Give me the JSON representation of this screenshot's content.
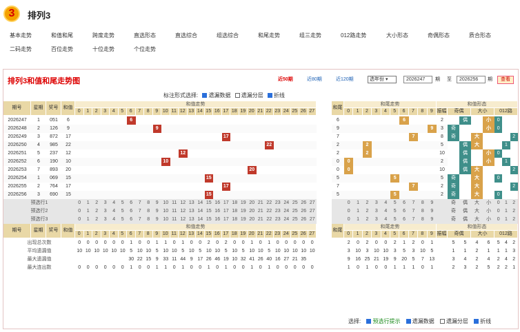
{
  "app": {
    "title": "排列3",
    "logo_text": "3"
  },
  "nav": [
    "基本走势",
    "和值和尾",
    "跨度走势",
    "直选形态",
    "直选综合",
    "组选综合",
    "和尾走势",
    "组三走势",
    "012路走势",
    "大小形态",
    "奇偶形态",
    "质合形态",
    "二码走势",
    "百位走势",
    "十位走势",
    "个位走势"
  ],
  "panel": {
    "title": "排列3和值和尾走势图",
    "quick": [
      "近50期",
      "近80期",
      "近120期"
    ],
    "select": "选年份",
    "from": "2026247",
    "from_suffix": "期",
    "to_label": "至",
    "to": "2026256",
    "to_suffix": "期",
    "query": "查看",
    "opts_label": "标注形式选择:",
    "opts": [
      {
        "label": "遗漏数据",
        "on": true
      },
      {
        "label": "遗漏分层",
        "on": false
      },
      {
        "label": "折线",
        "on": true
      }
    ]
  },
  "table": {
    "h_issue": "期号",
    "h_week": "星期",
    "h_prize": "奖号",
    "h_sum": "和值",
    "h_sumtrend": "和值走势",
    "h_tail": "和尾",
    "h_tailtrend": "和尾走势",
    "h_form": "和值形态",
    "h_switch": "[切换]",
    "h_zhen": "振幅",
    "h_oe": "奇偶",
    "h_bs": "大小",
    "h_012": "012路",
    "sub_odd": "奇",
    "sub_even": "偶",
    "sub_big": "大",
    "sub_small": "小",
    "sub_0": "0",
    "sub_1": "1",
    "sub_2": "2",
    "rows": [
      {
        "issue": "2026247",
        "week": "1",
        "prize": "051",
        "sum": "6",
        "tail": "6",
        "zhen": "2",
        "oe": "偶",
        "bs": "小",
        "m3": "0"
      },
      {
        "issue": "2026248",
        "week": "2",
        "prize": "126",
        "sum": "9",
        "tail": "9",
        "zhen": "3",
        "oe": "奇",
        "bs": "小",
        "m3": "0"
      },
      {
        "issue": "2026249",
        "week": "3",
        "prize": "872",
        "sum": "17",
        "tail": "7",
        "zhen": "8",
        "oe": "奇",
        "bs": "大",
        "m3": "2"
      },
      {
        "issue": "2026250",
        "week": "4",
        "prize": "985",
        "sum": "22",
        "tail": "2",
        "zhen": "5",
        "oe": "偶",
        "bs": "大",
        "m3": "1"
      },
      {
        "issue": "2026251",
        "week": "5",
        "prize": "237",
        "sum": "12",
        "tail": "2",
        "zhen": "10",
        "oe": "偶",
        "bs": "小",
        "m3": "0"
      },
      {
        "issue": "2026252",
        "week": "6",
        "prize": "190",
        "sum": "10",
        "tail": "0",
        "zhen": "2",
        "oe": "偶",
        "bs": "小",
        "m3": "1"
      },
      {
        "issue": "2026253",
        "week": "7",
        "prize": "893",
        "sum": "20",
        "tail": "0",
        "zhen": "10",
        "oe": "偶",
        "bs": "大",
        "m3": "2"
      },
      {
        "issue": "2026254",
        "week": "1",
        "prize": "069",
        "sum": "15",
        "tail": "5",
        "zhen": "5",
        "oe": "奇",
        "bs": "大",
        "m3": "0"
      },
      {
        "issue": "2026255",
        "week": "2",
        "prize": "764",
        "sum": "17",
        "tail": "7",
        "zhen": "2",
        "oe": "奇",
        "bs": "大",
        "m3": "2"
      },
      {
        "issue": "2026256",
        "week": "3",
        "prize": "690",
        "sum": "15",
        "tail": "5",
        "zhen": "2",
        "oe": "奇",
        "bs": "大",
        "m3": "0"
      }
    ],
    "predict": [
      "预选行1",
      "预选行2",
      "预选行3"
    ],
    "stats": [
      {
        "label": "出现总次数",
        "sum": [
          "0",
          "0",
          "0",
          "0",
          "0",
          "0",
          "1",
          "0",
          "0",
          "1",
          "1",
          "0",
          "1",
          "0",
          "0",
          "2",
          "0",
          "2",
          "0",
          "0",
          "1",
          "0",
          "1",
          "0",
          "0",
          "0",
          "0",
          "0"
        ],
        "tail": [
          "2",
          "0",
          "2",
          "0",
          "0",
          "2",
          "1",
          "2",
          "0",
          "1"
        ],
        "zhen": "",
        "form": [
          "5",
          "5",
          "4",
          "6",
          "5",
          "4",
          "2",
          "3"
        ]
      },
      {
        "label": "平均遗漏值",
        "sum": [
          "10",
          "10",
          "10",
          "10",
          "10",
          "10",
          "5",
          "10",
          "10",
          "5",
          "10",
          "10",
          "5",
          "10",
          "5",
          "10",
          "10",
          "5",
          "10",
          "5",
          "10",
          "10",
          "5",
          "10",
          "10",
          "10",
          "10",
          "10"
        ],
        "tail": [
          "3",
          "10",
          "3",
          "10",
          "10",
          "3",
          "5",
          "3",
          "10",
          "5"
        ],
        "zhen": "",
        "form": [
          "1",
          "1",
          "2",
          "1",
          "1",
          "1",
          "3",
          "2"
        ]
      },
      {
        "label": "最大遗漏值",
        "sum": [
          "",
          "",
          "",
          "",
          "",
          "",
          "30",
          "22",
          "15",
          "9",
          "33",
          "11",
          "44",
          "9",
          "17",
          "26",
          "46",
          "19",
          "10",
          "32",
          "41",
          "26",
          "40",
          "16",
          "27",
          "21",
          "35",
          ""
        ],
        "tail": [
          "9",
          "16",
          "25",
          "21",
          "19",
          "9",
          "20",
          "5",
          "7",
          "13"
        ],
        "zhen": "",
        "form": [
          "3",
          "4",
          "2",
          "4",
          "2",
          "4",
          "2",
          "3"
        ]
      },
      {
        "label": "最大连出数",
        "sum": [
          "0",
          "0",
          "0",
          "0",
          "0",
          "0",
          "1",
          "0",
          "0",
          "1",
          "1",
          "0",
          "1",
          "0",
          "0",
          "1",
          "0",
          "1",
          "0",
          "0",
          "1",
          "0",
          "1",
          "0",
          "0",
          "0",
          "0",
          "0"
        ],
        "tail": [
          "1",
          "0",
          "1",
          "0",
          "0",
          "1",
          "1",
          "1",
          "0",
          "1"
        ],
        "zhen": "",
        "form": [
          "2",
          "3",
          "2",
          "5",
          "2",
          "2",
          "1",
          "1"
        ]
      }
    ],
    "legend_label": "选择:",
    "legend": [
      {
        "label": "预选行提示",
        "on": true
      },
      {
        "label": "遗漏数据",
        "on": true
      },
      {
        "label": "遗漏分层",
        "on": false
      },
      {
        "label": "折线",
        "on": true
      }
    ]
  },
  "colors": {
    "hit": "#c0392b",
    "tail_hit": "#d9a24a",
    "form_hit": "#3f8f8a",
    "header": "#f7ecce"
  }
}
